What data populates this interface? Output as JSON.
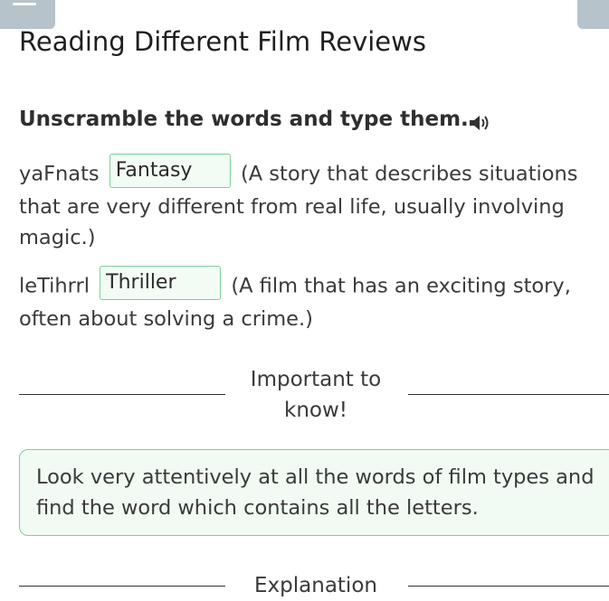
{
  "page": {
    "title": "Reading Different Film Reviews"
  },
  "task": {
    "instruction": "Unscramble the words and type them.",
    "audio_icon": "speaker-icon"
  },
  "items": [
    {
      "scrambled": "yaFnats",
      "answer": "Fantasy",
      "definition": "(A story that describes situations that are very different from real life, usually involving magic.)"
    },
    {
      "scrambled": "leTihrrl",
      "answer": "Thriller",
      "definition": "(A film that has an exciting story, often about solving a crime.)"
    }
  ],
  "important": {
    "heading": "Important to know!",
    "note": "Look very attentively at all the words of film types and find the word which contains all the letters."
  },
  "explanation": {
    "heading": "Explanation"
  },
  "colors": {
    "answer_border": "#7dcf9b",
    "answer_bg": "#f2fbf4",
    "corner_buttons": "#b6c3ca"
  },
  "icons": {
    "menu": "menu-icon",
    "check": "check-icon"
  }
}
